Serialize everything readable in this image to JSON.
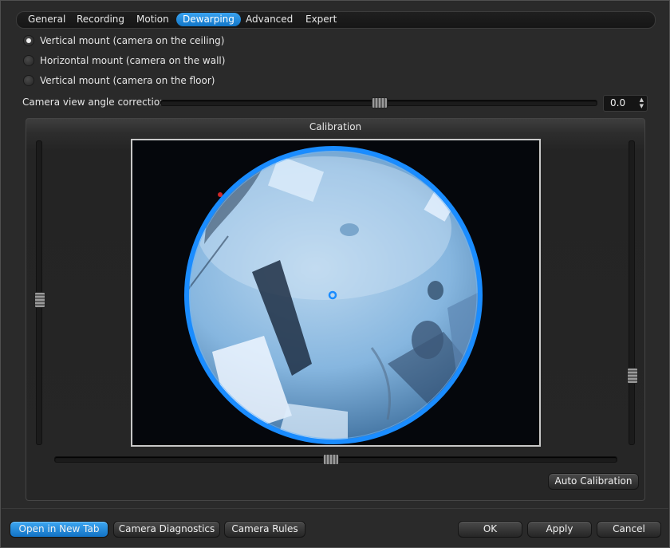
{
  "tabs": [
    "General",
    "Recording",
    "Motion",
    "Dewarping",
    "Advanced",
    "Expert"
  ],
  "active_tab": "Dewarping",
  "mount_options": [
    {
      "label": "Vertical mount (camera on the ceiling)",
      "checked": true
    },
    {
      "label": "Horizontal mount (camera on the wall)",
      "checked": false
    },
    {
      "label": "Vertical mount (camera on the floor)",
      "checked": false
    }
  ],
  "angle_correction": {
    "label": "Camera view angle correction:",
    "value": "0.0",
    "slider_fraction": 0.5
  },
  "calibration": {
    "title": "Calibration",
    "auto_button": "Auto Calibration",
    "vertical_left_fraction": 0.52,
    "vertical_right_fraction": 0.77,
    "horizontal_fraction": 0.49
  },
  "footer": {
    "open_new_tab": "Open in New Tab",
    "diagnostics": "Camera Diagnostics",
    "rules": "Camera Rules",
    "ok": "OK",
    "apply": "Apply",
    "cancel": "Cancel"
  },
  "colors": {
    "accent": "#1e88e5",
    "circle": "#1a8cff"
  }
}
